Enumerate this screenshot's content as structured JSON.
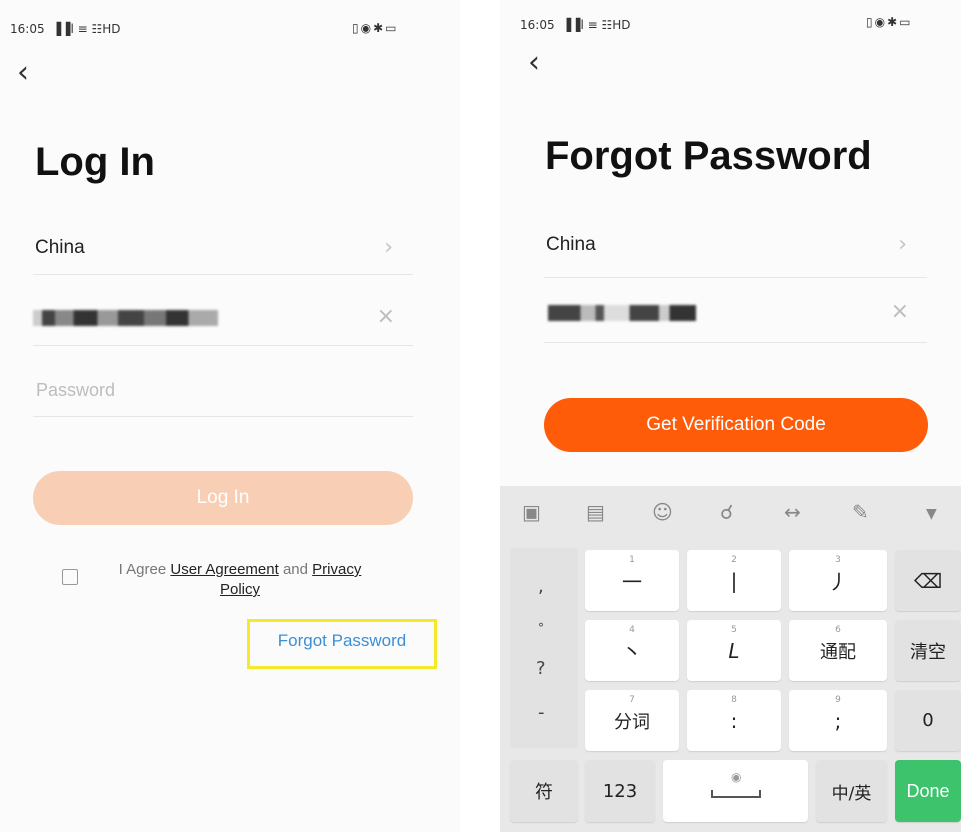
{
  "left_screen": {
    "status_time": "16:05",
    "status_signal": "▐▐l ≡ ☷HD",
    "status_right": "▯◉✱▭",
    "title": "Log In",
    "country": "China",
    "phone_masked": "",
    "password_placeholder": "Password",
    "login_button": "Log In",
    "agree_prefix": "I Agree",
    "user_agreement": "User Agreement",
    "agree_and": "and",
    "privacy_policy_1": "Privacy",
    "privacy_policy_2": "Policy",
    "forgot_password": "Forgot Password"
  },
  "right_screen": {
    "status_time": "16:05",
    "status_signal": "▐▐l ≡ ☷HD",
    "status_right": "▯◉✱▭",
    "title": "Forgot Password",
    "country": "China",
    "phone_masked": "",
    "get_code_button": "Get Verification Code"
  },
  "keyboard": {
    "keys": [
      {
        "sub": "1",
        "label": "一"
      },
      {
        "sub": "2",
        "label": "|"
      },
      {
        "sub": "3",
        "label": "丿"
      },
      {
        "sub": "4",
        "label": "丶"
      },
      {
        "sub": "5",
        "label": "L"
      },
      {
        "sub": "6",
        "label": "通配"
      },
      {
        "sub": "7",
        "label": "分词"
      },
      {
        "sub": "8",
        "label": ":"
      },
      {
        "sub": "9",
        "label": ";"
      }
    ],
    "left_col": [
      ",",
      "°",
      "?",
      "-"
    ],
    "clear": "清空",
    "zero": "0",
    "symbol": "符",
    "num": "123",
    "lang": "中/英",
    "done": "Done"
  },
  "colors": {
    "accent": "#ff5c0a",
    "accent_disabled": "#f8cfb4",
    "link": "#3b8fd6",
    "highlight": "#f5ea2a",
    "done": "#3cc36b"
  }
}
